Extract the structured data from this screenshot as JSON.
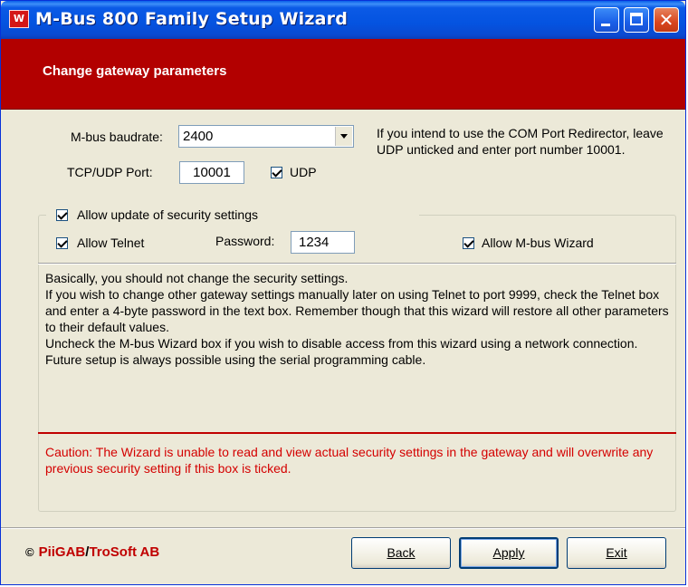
{
  "window": {
    "title": "M-Bus 800 Family Setup Wizard",
    "icon_letter": "W",
    "controls": {
      "minimize_icon": "minimize-icon",
      "maximize_icon": "maximize-icon",
      "close_icon": "close-icon",
      "close_glyph": "✕"
    }
  },
  "header": {
    "title": "Change gateway parameters",
    "band_color": "#b20000"
  },
  "settings": {
    "baudrate_label": "M-bus baudrate:",
    "baudrate_value": "2400",
    "tcp_label": "TCP/UDP Port:",
    "tcp_value": "10001",
    "udp_label": "UDP",
    "udp_checked": true,
    "info_text": "If you intend to use the COM Port Redirector, leave UDP unticked and enter port number 10001."
  },
  "security": {
    "allow_update_label": "Allow update of security settings",
    "allow_update_checked": true,
    "telnet_label": "Allow Telnet",
    "telnet_checked": true,
    "password_label": "Password:",
    "password_value": "1234",
    "mbus_wizard_label": "Allow M-bus Wizard",
    "mbus_wizard_checked": true,
    "explanation": [
      "Basically, you should not change the security settings.",
      "If you wish to change other gateway settings manually later on using Telnet to port 9999, check the Telnet box and enter a 4-byte password in the text box. Remember though that this wizard will restore all other parameters to their default values.",
      "Uncheck the M-bus Wizard box if you wish to disable access from this wizard using a network connection. Future setup is always possible using the serial programming cable."
    ],
    "caution": "Caution: The Wizard is unable to read and view actual security settings in the gateway and will overwrite any previous security setting if this box is ticked.",
    "caution_color": "#d40000"
  },
  "footer": {
    "copyright_symbol": "©",
    "company_a": "PiiGAB",
    "slash": "/",
    "company_b": "TroSoft AB",
    "back_label": "Back",
    "apply_label": "Apply",
    "exit_label": "Exit"
  }
}
